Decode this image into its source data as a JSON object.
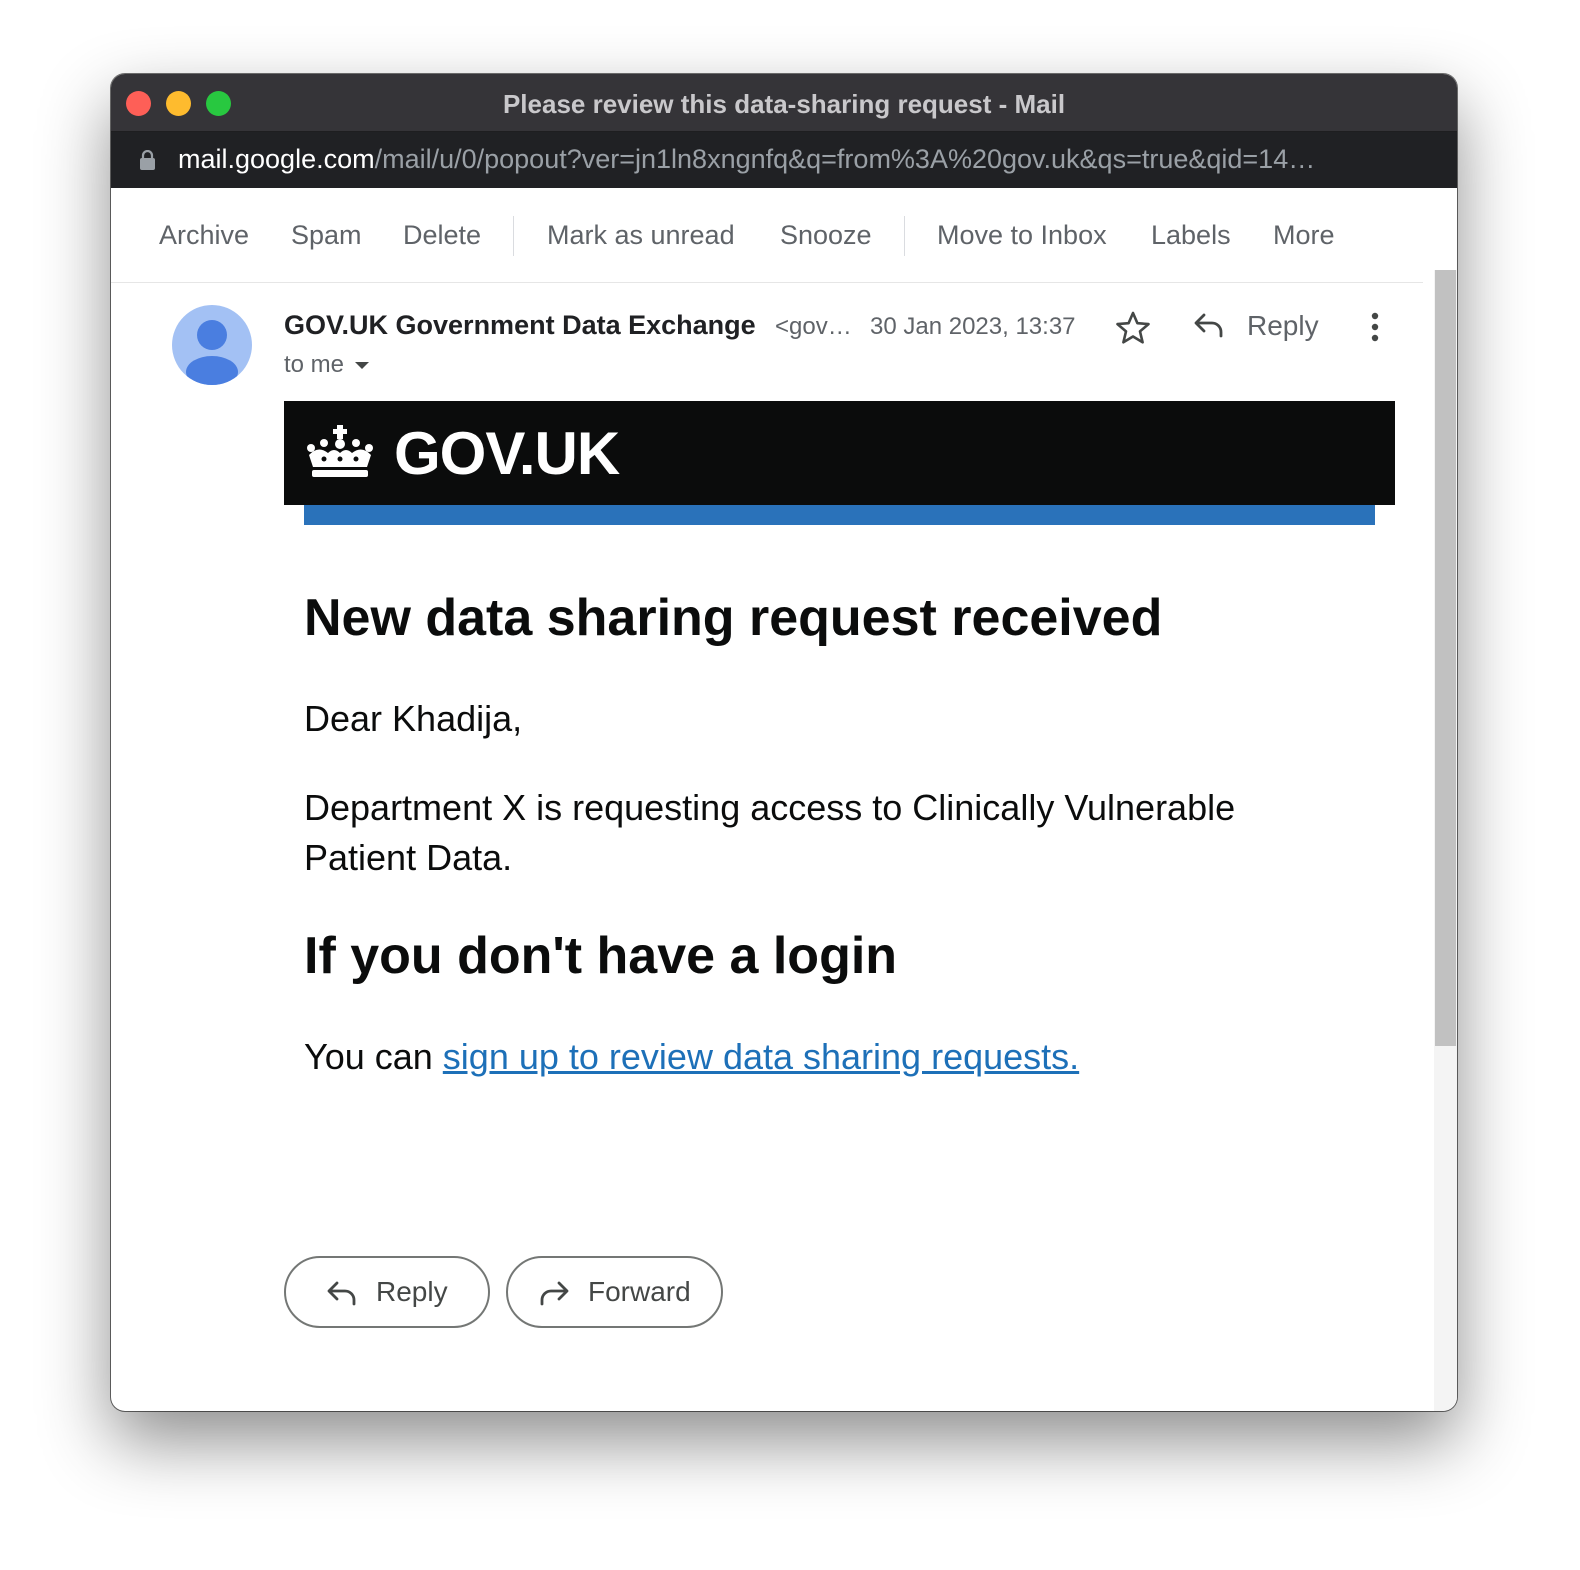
{
  "window": {
    "title": "Please review this data-sharing request - Mail",
    "url_host": "mail.google.com",
    "url_path": "/mail/u/0/popout?ver=jn1ln8xngnfq&q=from%3A%20gov.uk&qs=true&qid=14…"
  },
  "toolbar": {
    "archive": "Archive",
    "spam": "Spam",
    "delete": "Delete",
    "mark_unread": "Mark as unread",
    "snooze": "Snooze",
    "move_inbox": "Move to Inbox",
    "labels": "Labels",
    "more": "More"
  },
  "message": {
    "sender_name": "GOV.UK Government Data Exchange",
    "sender_email": "<gov…",
    "date": "30 Jan 2023, 13:37",
    "reply_label": "Reply",
    "recipient": "to me"
  },
  "email_body": {
    "logo_text": "GOV.UK",
    "heading": "New data sharing request received",
    "greeting": "Dear Khadija,",
    "paragraph": "Department X is requesting access to Clinically Vulnerable Patient Data.",
    "subheading": "If you don't have a login",
    "signup_prefix": "You can ",
    "signup_link": "sign up to review data sharing requests."
  },
  "actions": {
    "reply": "Reply",
    "forward": "Forward"
  },
  "colors": {
    "gov_black": "#0b0c0c",
    "gov_blue": "#2a72ba",
    "link": "#1d70b8",
    "avatar": "#a3c1f4"
  },
  "icons": [
    "lock-icon",
    "person-icon",
    "star-icon",
    "reply-icon",
    "more-vert-icon",
    "dropdown-arrow-icon",
    "crown-icon",
    "forward-icon"
  ]
}
